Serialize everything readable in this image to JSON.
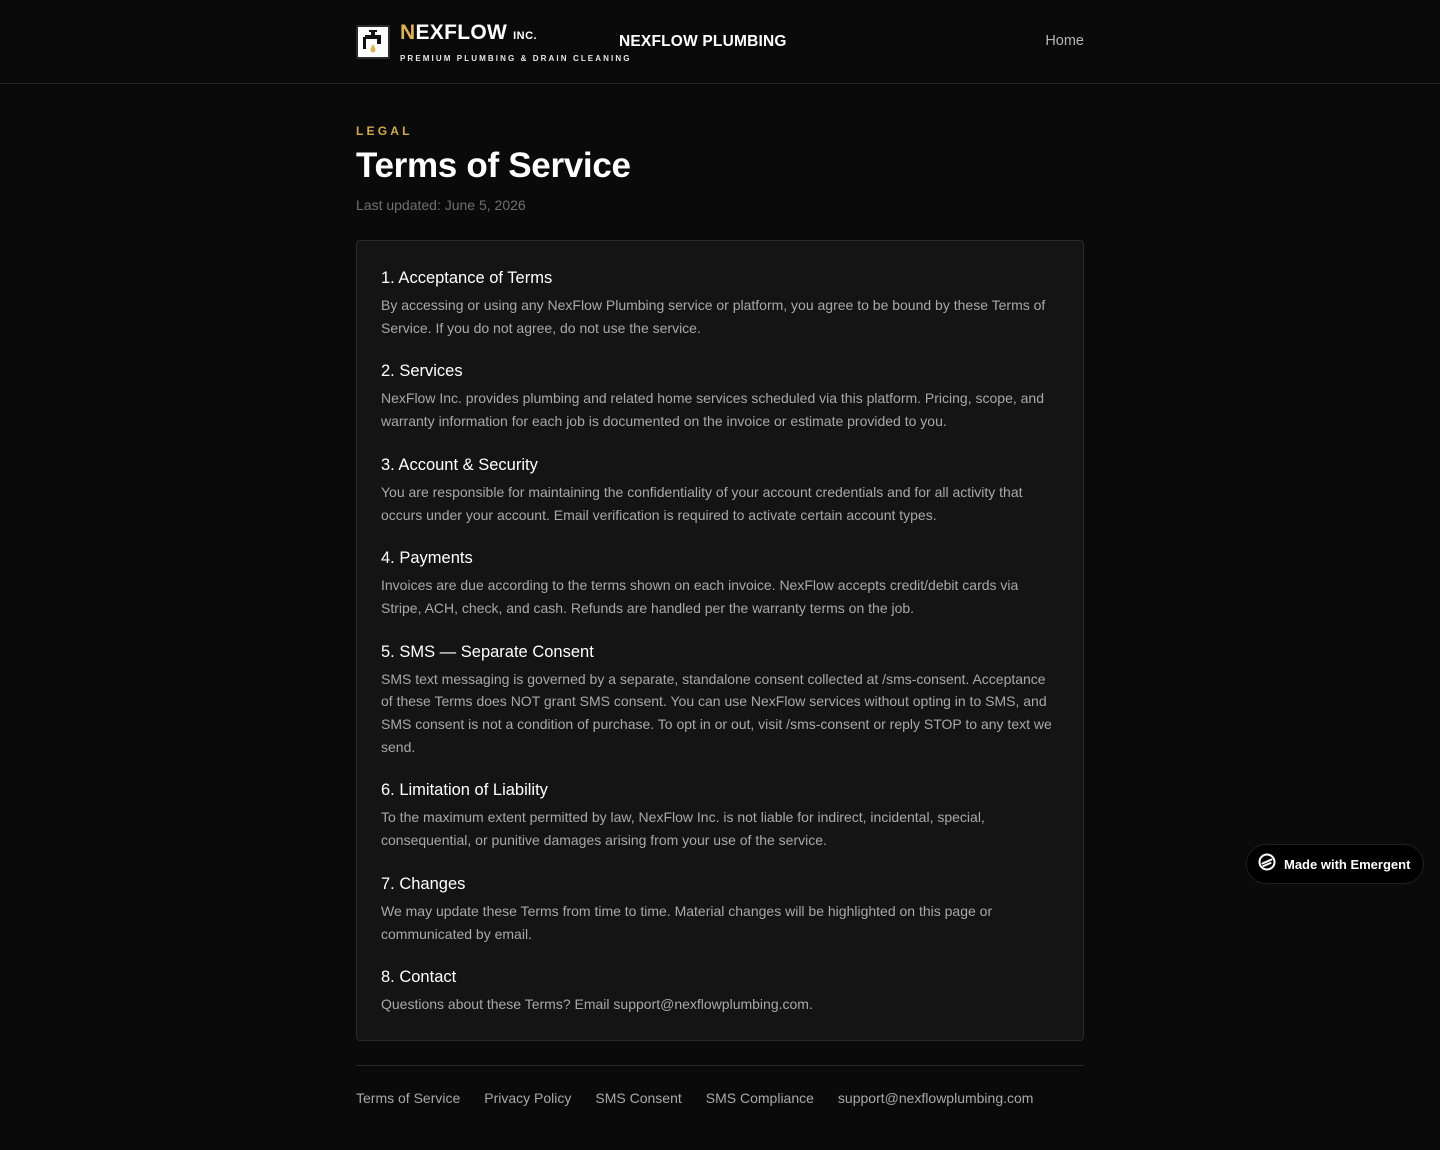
{
  "header": {
    "brand_initial": "N",
    "brand_rest": "EXFLOW",
    "brand_suffix": "INC.",
    "tagline": "PREMIUM PLUMBING & DRAIN CLEANING",
    "site_title": "NEXFLOW PLUMBING",
    "nav_home": "Home",
    "logo_icon": "faucet-icon"
  },
  "page": {
    "eyebrow": "LEGAL",
    "title": "Terms of Service",
    "last_updated": "Last updated: June 5, 2026"
  },
  "sections": [
    {
      "heading": "1. Acceptance of Terms",
      "body": "By accessing or using any NexFlow Plumbing service or platform, you agree to be bound by these Terms of Service. If you do not agree, do not use the service."
    },
    {
      "heading": "2. Services",
      "body": "NexFlow Inc. provides plumbing and related home services scheduled via this platform. Pricing, scope, and warranty information for each job is documented on the invoice or estimate provided to you."
    },
    {
      "heading": "3. Account & Security",
      "body": "You are responsible for maintaining the confidentiality of your account credentials and for all activity that occurs under your account. Email verification is required to activate certain account types."
    },
    {
      "heading": "4. Payments",
      "body": "Invoices are due according to the terms shown on each invoice. NexFlow accepts credit/debit cards via Stripe, ACH, check, and cash. Refunds are handled per the warranty terms on the job."
    },
    {
      "heading": "5. SMS — Separate Consent",
      "body": "SMS text messaging is governed by a separate, standalone consent collected at /sms-consent. Acceptance of these Terms does NOT grant SMS consent. You can use NexFlow services without opting in to SMS, and SMS consent is not a condition of purchase. To opt in or out, visit /sms-consent or reply STOP to any text we send."
    },
    {
      "heading": "6. Limitation of Liability",
      "body": "To the maximum extent permitted by law, NexFlow Inc. is not liable for indirect, incidental, special, consequential, or punitive damages arising from your use of the service."
    },
    {
      "heading": "7. Changes",
      "body": "We may update these Terms from time to time. Material changes will be highlighted on this page or communicated by email."
    },
    {
      "heading": "8. Contact",
      "body": "Questions about these Terms? Email support@nexflowplumbing.com."
    }
  ],
  "footer": {
    "links": [
      "Terms of Service",
      "Privacy Policy",
      "SMS Consent",
      "SMS Compliance",
      "support@nexflowplumbing.com"
    ]
  },
  "badge": {
    "label": "Made with Emergent",
    "icon": "emergent-logo-icon"
  },
  "colors": {
    "background": "#0a0a0a",
    "card": "#141414",
    "accent_gold": "#d4a943",
    "text_muted": "#a8a8a8"
  }
}
